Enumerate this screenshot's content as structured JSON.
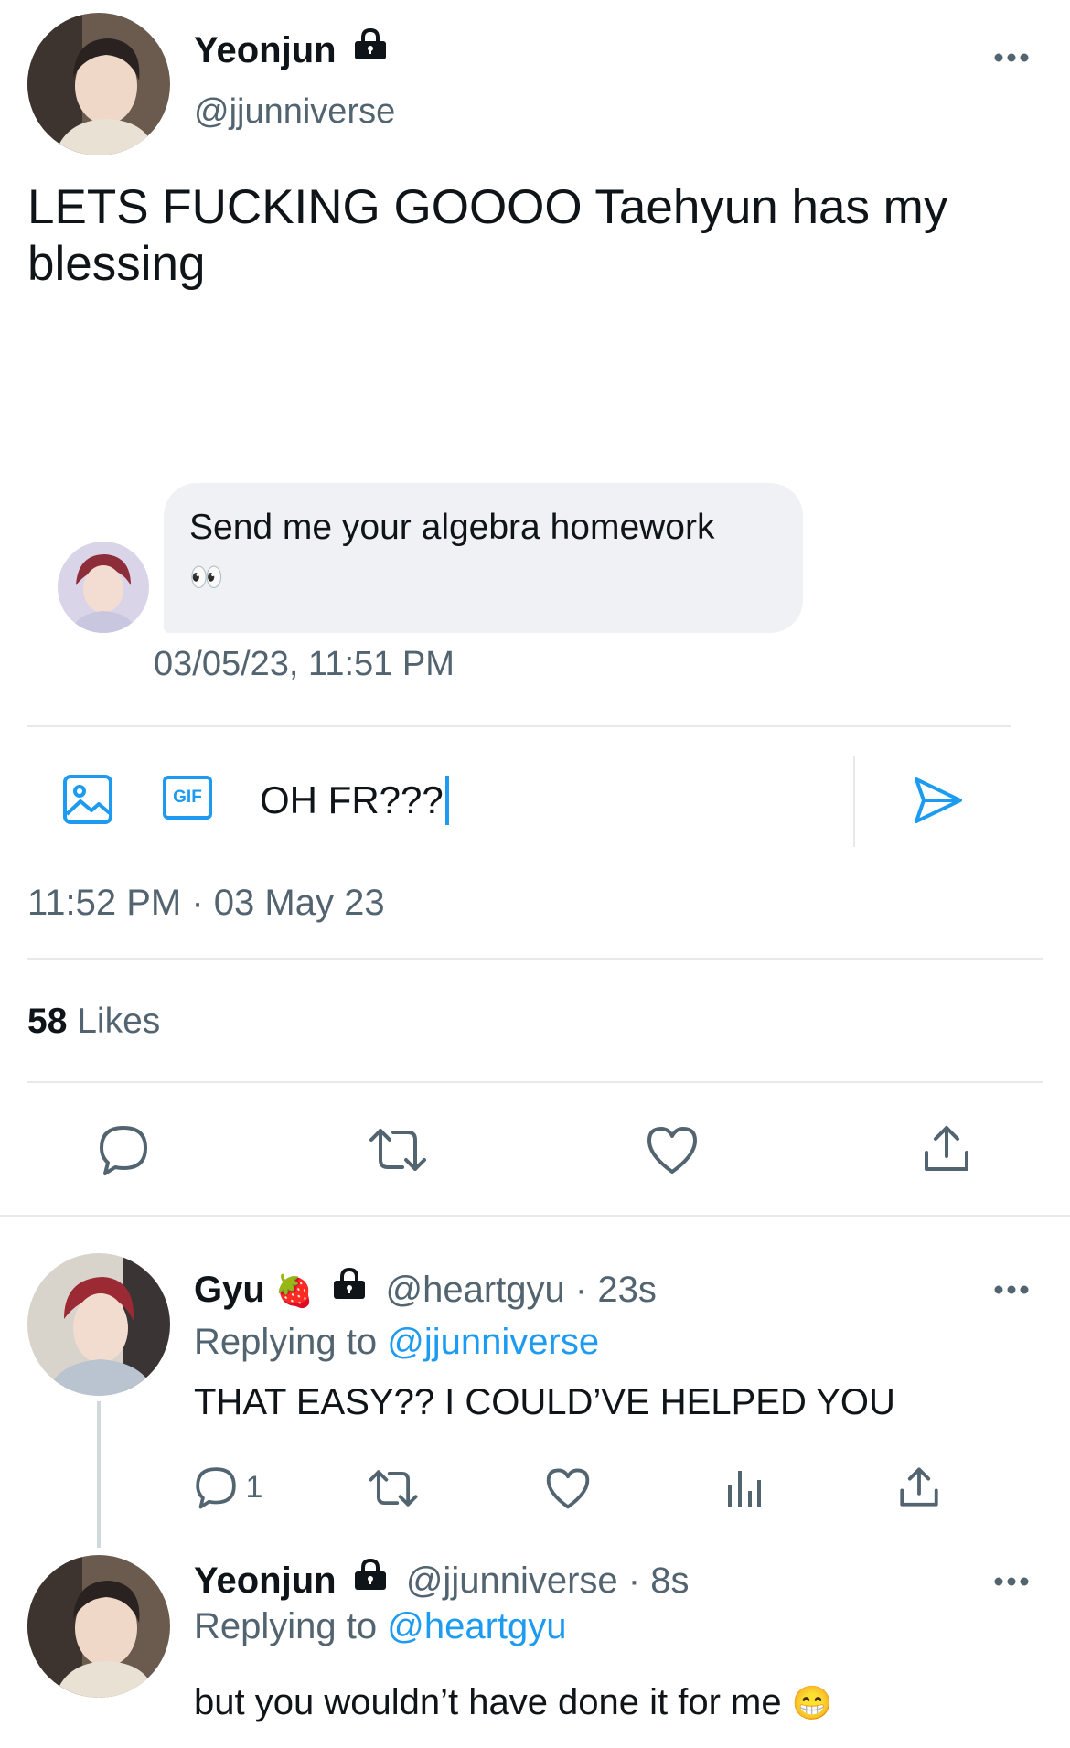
{
  "main_tweet": {
    "display_name": "Yeonjun",
    "handle": "@jjunniverse",
    "text": "LETS FUCKING GOOOO Taehyun has my blessing",
    "dm": {
      "message": "Send me your algebra homework",
      "emoji": "👀",
      "timestamp": "03/05/23, 11:51 PM"
    },
    "composer": {
      "gif_label": "GIF",
      "text": "OH FR???"
    },
    "time": "11:52 PM · 03 May 23",
    "likes_count": "58",
    "likes_label": "Likes"
  },
  "replies": [
    {
      "display_name": "Gyu",
      "emoji": "🍓",
      "handle": "@heartgyu",
      "age": "· 23s",
      "replying_prefix": "Replying to",
      "replying_to": "@jjunniverse",
      "text": "THAT EASY?? I COULD’VE HELPED YOU",
      "reply_count": "1"
    },
    {
      "display_name": "Yeonjun",
      "handle": "@jjunniverse",
      "age": "· 8s",
      "replying_prefix": "Replying to",
      "replying_to": "@heartgyu",
      "text": "but you wouldn’t have done it for me",
      "emoji": "😁"
    }
  ],
  "colors": {
    "accent": "#1d9bf0",
    "secondary_text": "#536471",
    "divider": "#e7e9ea",
    "dm_bubble": "#eff1f4"
  },
  "icons": [
    "more-icon",
    "lock-icon",
    "image-icon",
    "gif-icon",
    "send-icon",
    "reply-icon",
    "retweet-icon",
    "like-icon",
    "share-icon",
    "analytics-icon"
  ]
}
